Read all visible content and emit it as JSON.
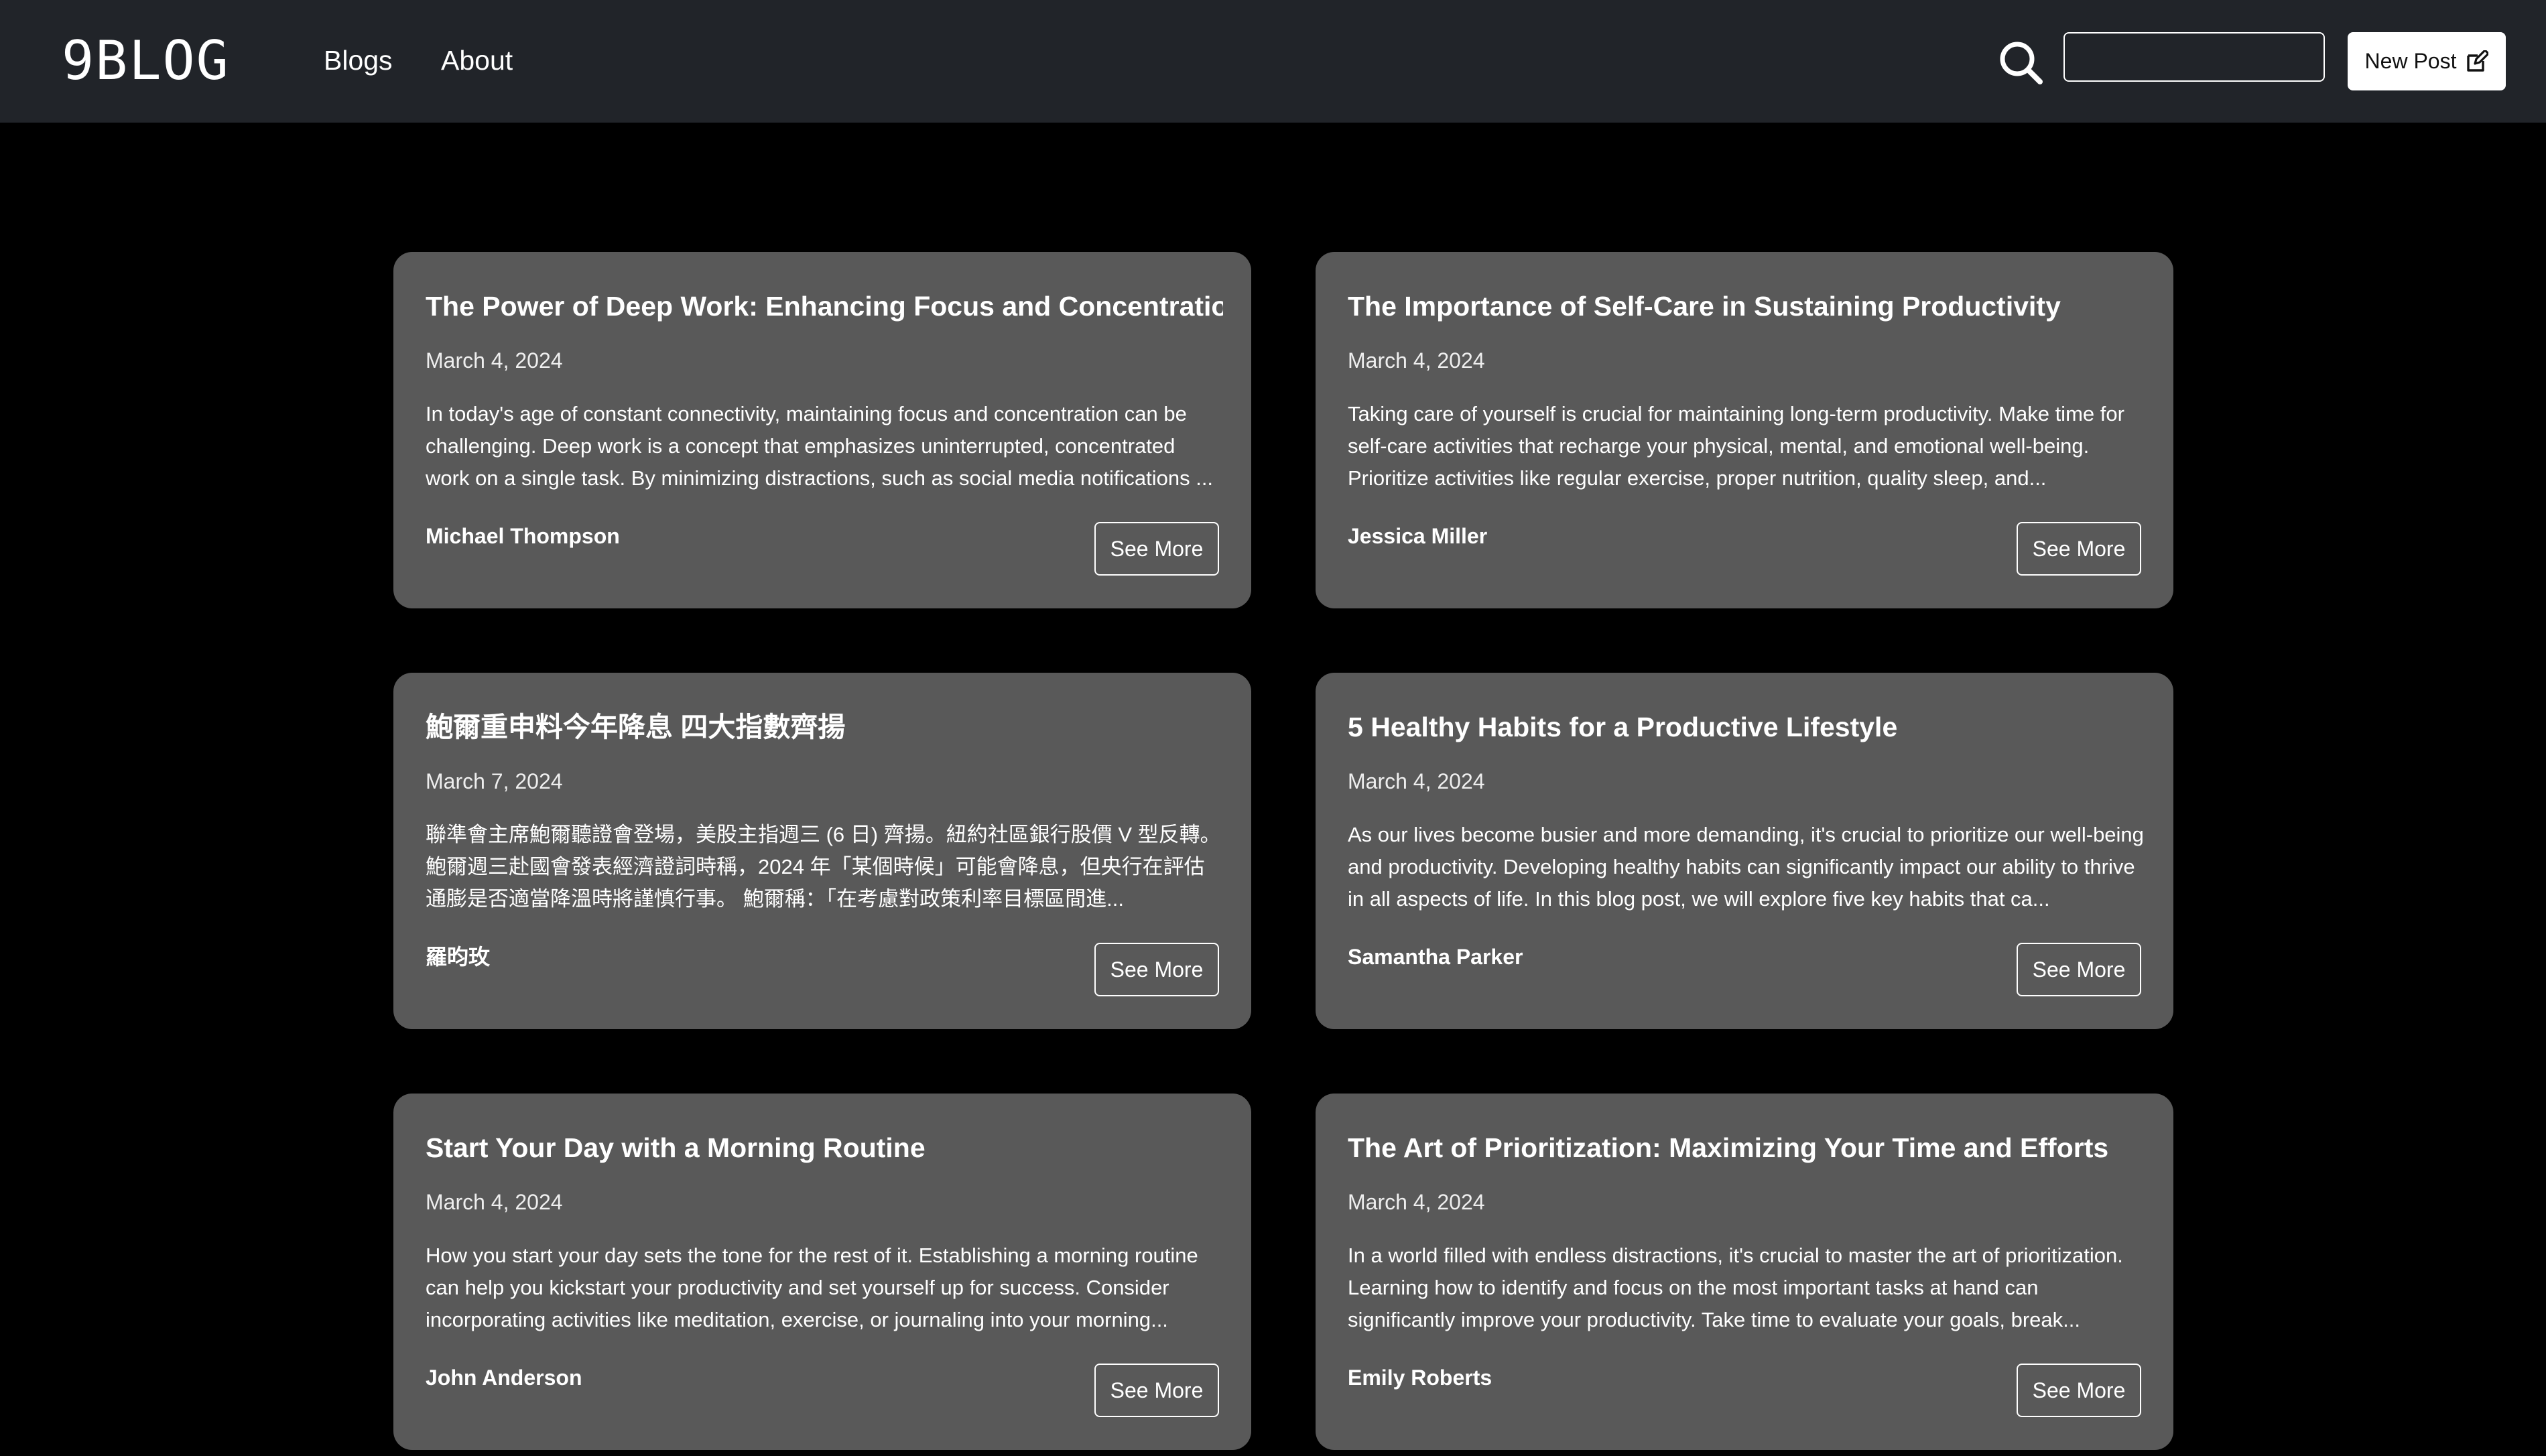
{
  "navbar": {
    "brand": "9BLOG",
    "links": [
      "Blogs",
      "About"
    ],
    "search": {
      "placeholder": "",
      "value": ""
    },
    "new_post_label": "New Post"
  },
  "posts": [
    {
      "title": "The Power of Deep Work: Enhancing Focus and Concentration",
      "date": "March 4, 2024",
      "excerpt": "In today's age of constant connectivity, maintaining focus and concentration can be challenging. Deep work is a concept that emphasizes uninterrupted, concentrated work on a single task. By minimizing distractions, such as social media notifications ...",
      "author": "Michael Thompson",
      "button": "See More"
    },
    {
      "title": "The Importance of Self-Care in Sustaining Productivity",
      "date": "March 4, 2024",
      "excerpt": "Taking care of yourself is crucial for maintaining long-term productivity. Make time for self-care activities that recharge your physical, mental, and emotional well-being. Prioritize activities like regular exercise, proper nutrition, quality sleep, and...",
      "author": "Jessica Miller",
      "button": "See More"
    },
    {
      "title": "鮑爾重申料今年降息 四大指數齊揚",
      "date": "March 7, 2024",
      "excerpt": "聯準會主席鮑爾聽證會登場，美股主指週三 (6 日) 齊揚。紐約社區銀行股價 V 型反轉。 鮑爾週三赴國會發表經濟證詞時稱，2024 年「某個時候」可能會降息，但央行在評估通膨是否適當降溫時將謹慎行事。 鮑爾稱：「在考慮對政策利率目標區間進...",
      "author": "羅昀玫",
      "button": "See More"
    },
    {
      "title": "5 Healthy Habits for a Productive Lifestyle",
      "date": "March 4, 2024",
      "excerpt": "As our lives become busier and more demanding, it's crucial to prioritize our well-being and productivity. Developing healthy habits can significantly impact our ability to thrive in all aspects of life. In this blog post, we will explore five key habits that ca...",
      "author": "Samantha Parker",
      "button": "See More"
    },
    {
      "title": "Start Your Day with a Morning Routine",
      "date": "March 4, 2024",
      "excerpt": "How you start your day sets the tone for the rest of it. Establishing a morning routine can help you kickstart your productivity and set yourself up for success. Consider incorporating activities like meditation, exercise, or journaling into your morning...",
      "author": "John Anderson",
      "button": "See More"
    },
    {
      "title": "The Art of Prioritization: Maximizing Your Time and Efforts",
      "date": "March 4, 2024",
      "excerpt": "In a world filled with endless distractions, it's crucial to master the art of prioritization. Learning how to identify and focus on the most important tasks at hand can significantly improve your productivity. Take time to evaluate your goals, break...",
      "author": "Emily Roberts",
      "button": "See More"
    }
  ],
  "colors": {
    "navbar_bg": "#212429",
    "page_bg": "#000000",
    "card_bg": "#595959",
    "text": "#ffffff"
  },
  "icons": {
    "search": "search-icon",
    "new_post": "edit-icon"
  }
}
